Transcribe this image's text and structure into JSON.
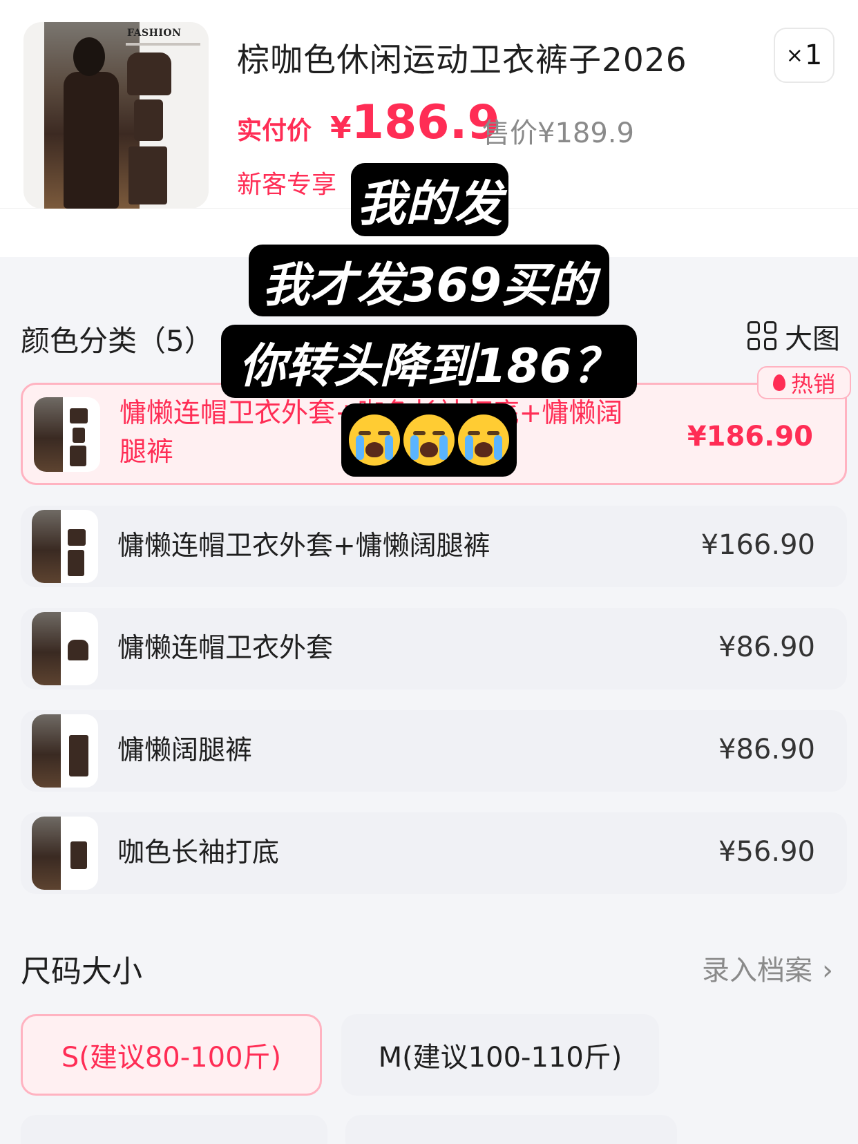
{
  "product": {
    "title": "棕咖色休闲运动卫衣裤子2026",
    "quantity_prefix": "×",
    "quantity": "1",
    "thumb_brand": "FASHION",
    "pay_label": "实付价",
    "pay_price_symbol": "¥",
    "pay_price": "186.9",
    "original_price": "售价¥189.9",
    "new_customer": "新客专享"
  },
  "color_section": {
    "title": "颜色分类（5）",
    "big_view_label": "大图",
    "hot_badge": "热销",
    "options": [
      {
        "label_line1": "慵懒连帽卫衣外套+咖色长袖打底+慵懒阔",
        "label_line2": "腿裤",
        "price": "¥186.90",
        "selected": true
      },
      {
        "label_line1": "慵懒连帽卫衣外套+慵懒阔腿裤",
        "label_line2": "",
        "price": "¥166.90",
        "selected": false
      },
      {
        "label_line1": "慵懒连帽卫衣外套",
        "label_line2": "",
        "price": "¥86.90",
        "selected": false
      },
      {
        "label_line1": "慵懒阔腿裤",
        "label_line2": "",
        "price": "¥86.90",
        "selected": false
      },
      {
        "label_line1": "咖色长袖打底",
        "label_line2": "",
        "price": "¥56.90",
        "selected": false
      }
    ]
  },
  "size_section": {
    "title": "尺码大小",
    "archive_link": "录入档案",
    "sizes": [
      {
        "label": "S(建议80-100斤)",
        "selected": true
      },
      {
        "label": "M(建议100-110斤)",
        "selected": false
      }
    ]
  },
  "overlay": {
    "line1": "我的发",
    "line2": "我才发369买的",
    "line3": "你转头降到186？",
    "emoji": "crying-face"
  },
  "colors": {
    "accent": "#ff2d55",
    "selected_bg": "#fff0f2",
    "selected_border": "#ffb3c1",
    "option_bg": "#f0f1f5"
  }
}
